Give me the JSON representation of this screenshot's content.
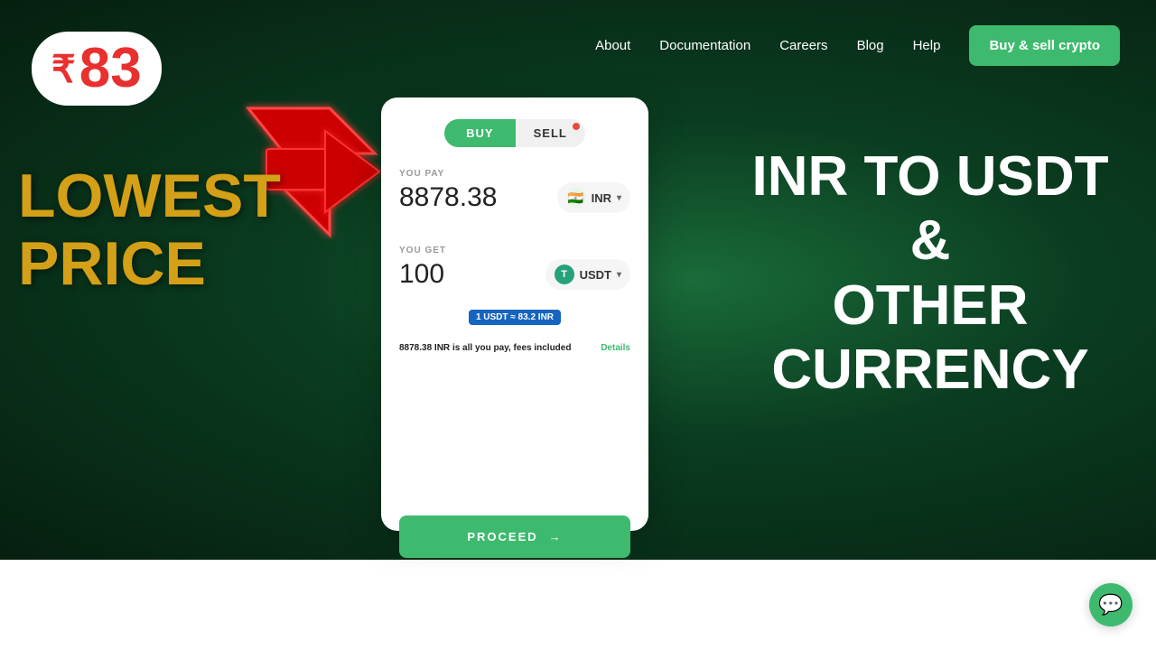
{
  "navbar": {
    "links": [
      {
        "label": "About",
        "id": "about"
      },
      {
        "label": "Documentation",
        "id": "documentation"
      },
      {
        "label": "Careers",
        "id": "careers"
      },
      {
        "label": "Blog",
        "id": "blog"
      },
      {
        "label": "Help",
        "id": "help"
      }
    ],
    "cta_label": "Buy & sell crypto"
  },
  "price_badge": {
    "rupee_symbol": "₹",
    "number": "83"
  },
  "left_text": {
    "line1": "LOWEST",
    "line2": "PRICE"
  },
  "card": {
    "tab_buy": "BUY",
    "tab_sell": "SELL",
    "you_pay_label": "YOU PAY",
    "you_pay_value": "8878.38",
    "you_get_label": "YOU GET",
    "you_get_value": "100",
    "currency_inr": "INR",
    "currency_usdt": "USDT",
    "rate_text": "1 USDT ≈ 83.2 INR",
    "fee_text_prefix": "8878.38 INR",
    "fee_text_suffix": "is all you pay, fees included",
    "details_label": "Details",
    "proceed_label": "PROCEED",
    "proceed_arrow": "→"
  },
  "right_text": {
    "line1": "INR TO USDT",
    "line2": "&",
    "line3": "OTHER",
    "line4": "CURRENCY"
  },
  "chat": {
    "icon": "💬"
  }
}
